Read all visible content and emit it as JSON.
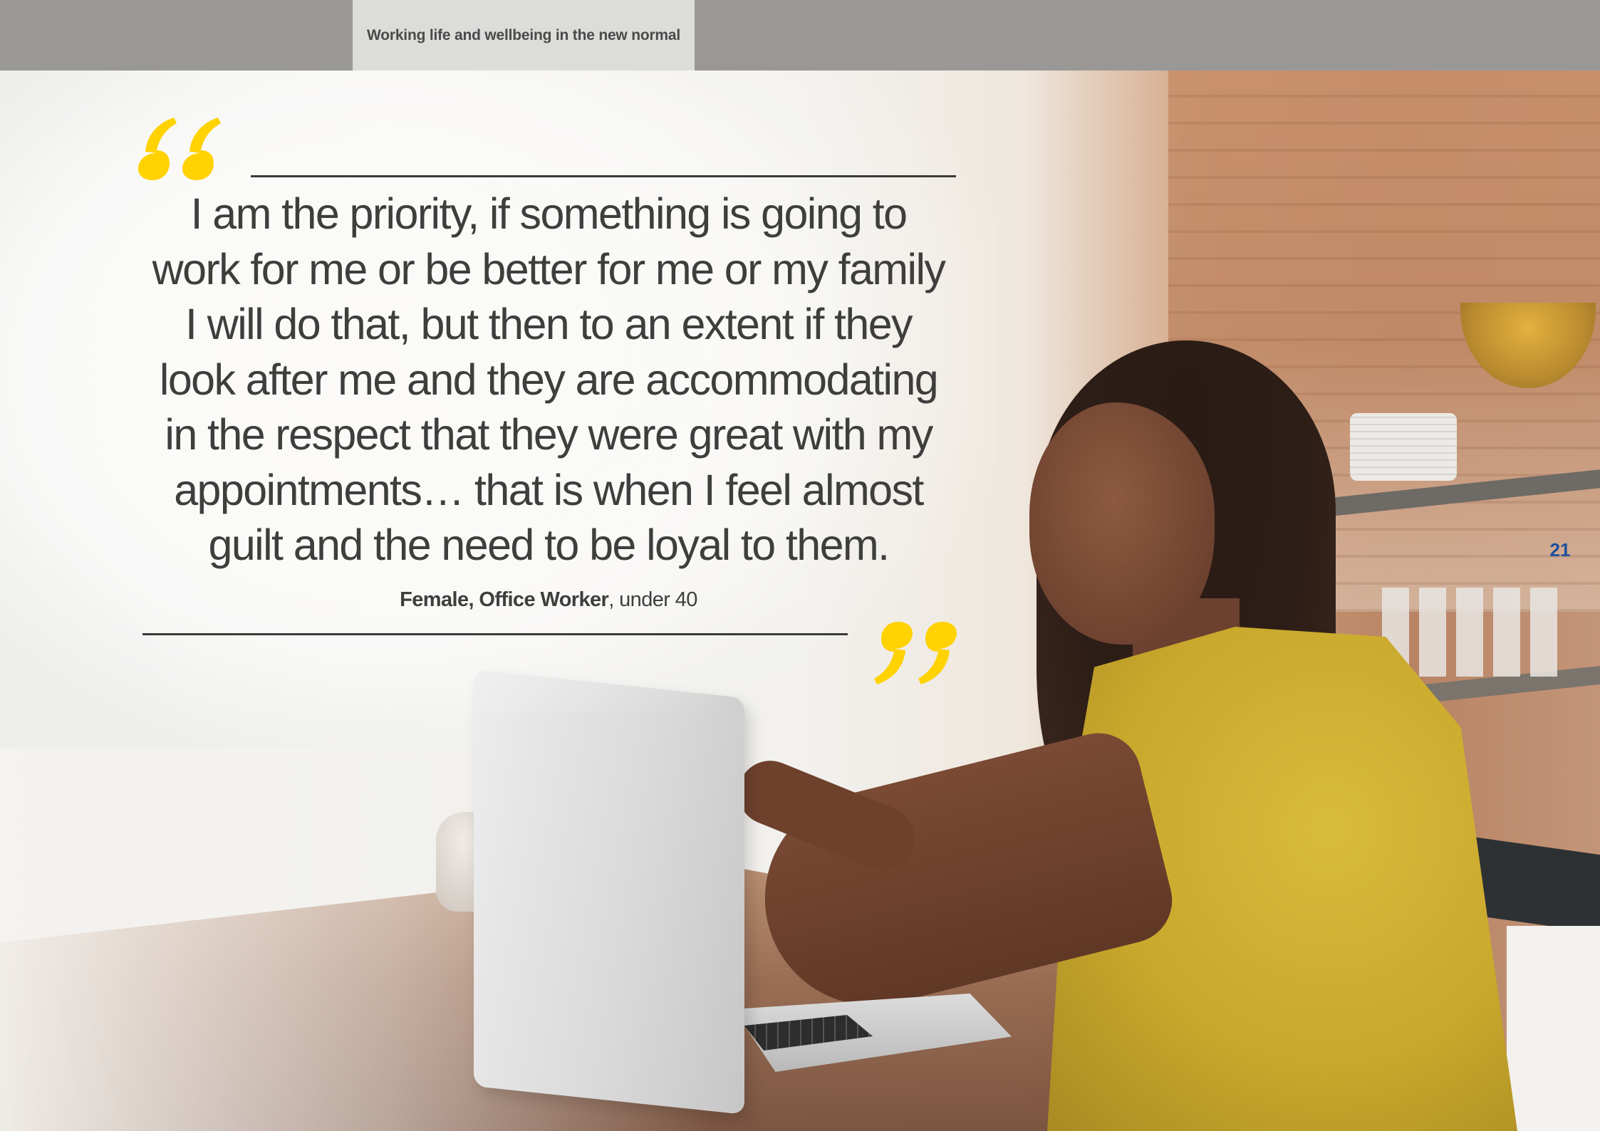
{
  "header": {
    "title": "Working life and wellbeing in the new normal"
  },
  "quote": {
    "lines": [
      "I am the priority, if something is going to",
      "work for me or be better for me or my family",
      "I will do that, but then to an extent if they",
      "look after me and they are accommodating",
      "in the respect that they were great with my",
      "appointments… that is when I feel almost",
      "guilt and the need to be loyal to them."
    ],
    "attribution_bold": "Female, Office Worker",
    "attribution_rest": ", under 40",
    "accent_color": "#FFD200"
  },
  "page_number": "21",
  "colors": {
    "header_band": "#999896",
    "header_tab": "#DCDCDB",
    "text": "#3E3E3D",
    "page_number": "#1F4F9C"
  }
}
